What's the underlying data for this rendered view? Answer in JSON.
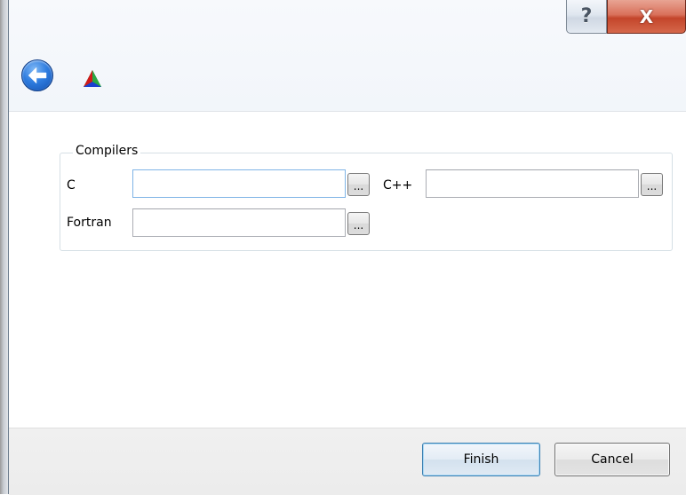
{
  "titlebar": {
    "help_glyph": "?",
    "close_glyph": "X"
  },
  "navigation": {
    "back_icon": "back-arrow-icon",
    "app_logo_icon": "rgb-triangle-logo-icon"
  },
  "compilers_group": {
    "title": "Compilers",
    "fields": {
      "c": {
        "label": "C",
        "value": "",
        "browse_label": "..."
      },
      "cpp": {
        "label": "C++",
        "value": "",
        "browse_label": "..."
      },
      "fortran": {
        "label": "Fortran",
        "value": "",
        "browse_label": "..."
      }
    }
  },
  "footer": {
    "finish_label": "Finish",
    "cancel_label": "Cancel"
  },
  "colors": {
    "close_button": "#c4452b",
    "back_button": "#2f7de0",
    "focused_input_border": "#7fb4e6",
    "default_button_border": "#3c7fb1"
  }
}
